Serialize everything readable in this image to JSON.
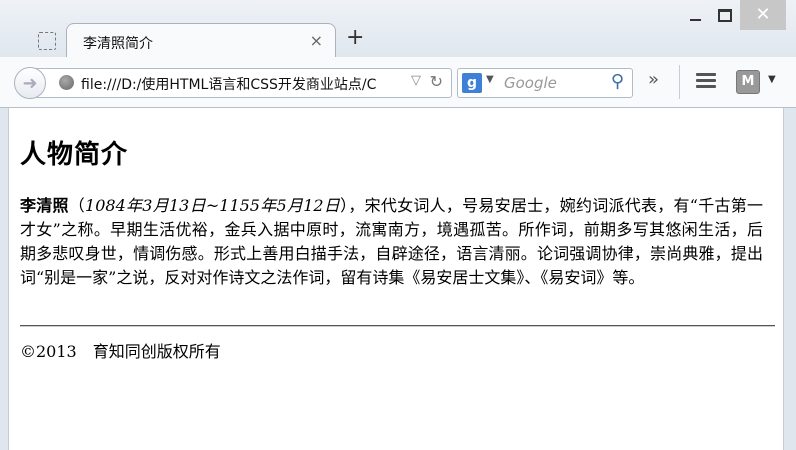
{
  "tab": {
    "title": "李清照简介",
    "close": "×",
    "new": "+"
  },
  "navbar": {
    "url": "file:///D:/使用HTML语言和CSS开发商业站点/C",
    "search_engine": "g",
    "search_placeholder": "Google"
  },
  "page": {
    "heading": "人物简介",
    "name": "李清照",
    "dates": "1084年3月13日~1155年5月12日",
    "open_paren": "（",
    "bio_text": "），宋代女词人，号易安居士，婉约词派代表，有“千古第一才女”之称。早期生活优裕，金兵入据中原时，流寓南方，境遇孤苦。所作词，前期多写其悠闲生活，后期多悲叹身世，情调伤感。形式上善用白描手法，自辟途径，语言清丽。论词强调协律，崇尚典雅，提出词“别是一家”之说，反对对作诗文之法作词，留有诗集《易安居士文集》、《易安词》等。",
    "footer": "©2013　育知同创版权所有"
  }
}
